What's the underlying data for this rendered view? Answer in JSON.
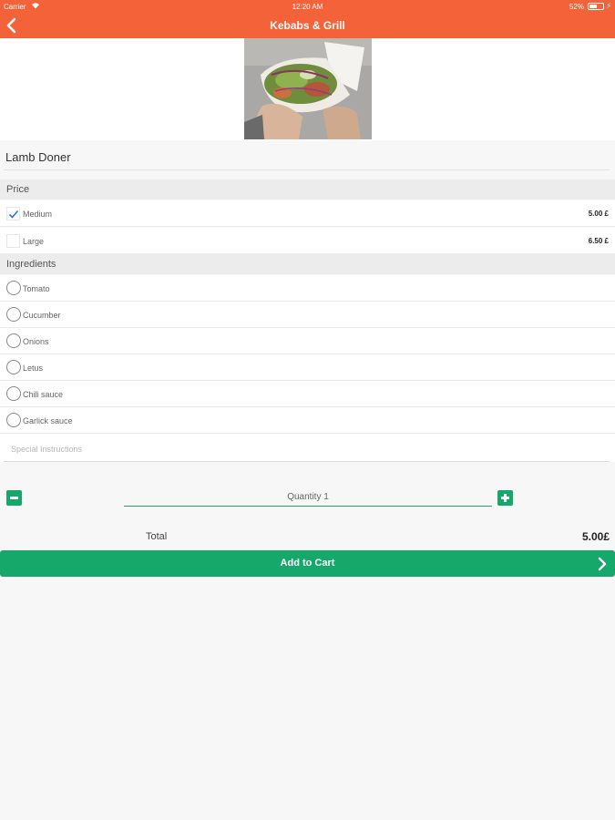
{
  "status_bar": {
    "carrier": "Carrier",
    "time": "12:20 AM",
    "battery": "52%",
    "charge": "⚡"
  },
  "nav": {
    "title": "Kebabs & Grill"
  },
  "item": {
    "name": "Lamb Doner"
  },
  "price_section": {
    "header": "Price",
    "options": [
      {
        "label": "Medium",
        "price": "5.00 £",
        "checked": true
      },
      {
        "label": "Large",
        "price": "6.50 £",
        "checked": false
      }
    ]
  },
  "ingredients_section": {
    "header": "Ingredients",
    "options": [
      {
        "label": "Tomato"
      },
      {
        "label": "Cucumber"
      },
      {
        "label": "Onions"
      },
      {
        "label": "Letus"
      },
      {
        "label": "Chili sauce"
      },
      {
        "label": "Garlick sauce"
      }
    ]
  },
  "special_instructions": {
    "placeholder": "Special Instructions"
  },
  "quantity": {
    "text": "Quantity  1"
  },
  "total": {
    "label": "Total",
    "value": "5.00£"
  },
  "cart": {
    "label": "Add to Cart"
  },
  "colors": {
    "primary": "#f4623a",
    "accent": "#16a86b",
    "check": "#2a78d8"
  }
}
